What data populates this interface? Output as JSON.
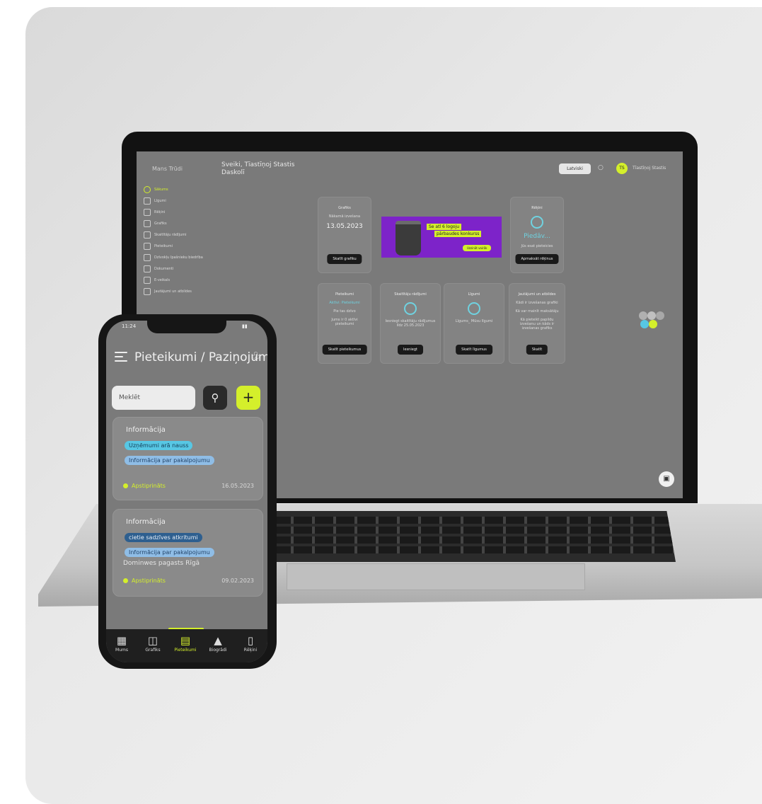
{
  "laptop": {
    "logo": "Mans Trūdi",
    "page_title": "Sveiki, Tīastīņoj Stastis Daskolī",
    "language": "Latviski",
    "user_initials": "TS",
    "user_name": "Tīastīņoj Stastis",
    "nav": [
      {
        "icon": "home-icon",
        "label": "Sākums",
        "active": true
      },
      {
        "icon": "grid-icon",
        "label": "Līgumi"
      },
      {
        "icon": "user-icon",
        "label": "Rēķini"
      },
      {
        "icon": "calendar-icon",
        "label": "Grafiks"
      },
      {
        "icon": "meter-icon",
        "label": "Skaitītāju rādījumi"
      },
      {
        "icon": "chat-icon",
        "label": "Pieteikumi"
      },
      {
        "icon": "people-icon",
        "label": "Dzīvokļu īpašnieku biedrība"
      },
      {
        "icon": "doc-icon",
        "label": "Dokumenti"
      },
      {
        "icon": "cart-icon",
        "label": "E-veikals"
      },
      {
        "icon": "help-icon",
        "label": "Jautājumi un atbildes"
      }
    ],
    "tiles": {
      "graph": {
        "title": "Grafiks",
        "label": "Nākamā izvešana",
        "date": "13.05.2023",
        "button": "Skatīt grafiku"
      },
      "bills": {
        "title": "Rēķini",
        "value": "Piedāv...",
        "label": "Jūs esat pieteicies",
        "button": "Apmaksāt rēķinus"
      },
      "requests": {
        "title": "Pieteikumi",
        "highlight": "Aktīvi: Pieteikumi",
        "line1": "Pie tas dzīvo",
        "line2": "Jums ir 0 aktīvi pieteikumi",
        "button": "Skatīt pieteikumus"
      },
      "meters": {
        "title": "Skaitītāju rādījumi",
        "line": "Iesniegt skaitītāju rādījumus līdz 25.05.2023",
        "button": "Iesniegt"
      },
      "contracts": {
        "title": "Līgumi",
        "line": "Līgums_ Mūsu līgumi",
        "button": "Skatīt līgumus"
      },
      "faq": {
        "title": "Jautājumi un atbildes",
        "line1": "Kādi ir izvešanas grafiki",
        "line2": "Kā var mainīt maksātāju",
        "line3": "Kā pieteikt papildu izvešanu un kāds ir izvešanas grafiks",
        "button": "Skatīt"
      }
    },
    "banner": {
      "line1": "Se atl 6 logoju",
      "line2": "pārbaudes konkurss",
      "button": "Uzzināt vairāk"
    }
  },
  "phone": {
    "time": "11:24",
    "title": "Pieteikumi / Paziņojumi",
    "search_placeholder": "Meklēt",
    "cards": [
      {
        "category": "Informācija",
        "tags": [
          "Uzņēmumi arā nauss",
          "Informācija par pakalpojumu"
        ],
        "subtitle": "",
        "status": "Apstiprināts",
        "date": "16.05.2023"
      },
      {
        "category": "Informācija",
        "tags": [
          "cietie sadzīves atkritumi",
          "Informācija par pakalpojumu"
        ],
        "subtitle": "Dominwes pagasts Rīgā",
        "status": "Apstiprināts",
        "date": "09.02.2023"
      }
    ],
    "tabs": [
      {
        "icon": "grid-icon",
        "label": "Mums"
      },
      {
        "icon": "calendar-icon",
        "label": "Grafiks"
      },
      {
        "icon": "chat-icon",
        "label": "Pieteikumi",
        "active": true
      },
      {
        "icon": "mountain-icon",
        "label": "Biogrādi"
      },
      {
        "icon": "doc-icon",
        "label": "Rēķini"
      }
    ]
  },
  "colors": {
    "accent": "#d4ef2b",
    "cyan": "#57c7e4",
    "screen_gray": "#7a7a7a"
  }
}
